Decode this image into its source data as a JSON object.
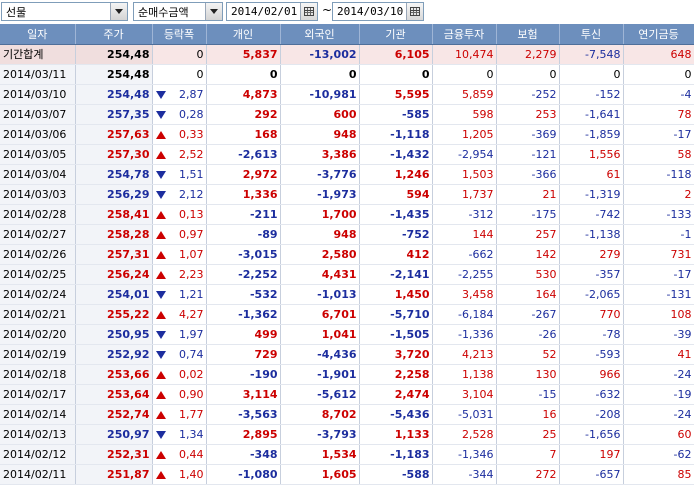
{
  "toolbar": {
    "market_select": "선물",
    "metric_select": "순매수금액",
    "start_date": "2014/02/01",
    "end_date": "2014/03/10",
    "range_separator": "~"
  },
  "colors": {
    "header_bg": "#6d8fbd",
    "up": "#cc0000",
    "down": "#1c2d9e",
    "summary_bg": "#f8e6e6"
  },
  "table": {
    "columns": [
      "일자",
      "주가",
      "등락폭",
      "개인",
      "외국인",
      "기관",
      "금융투자",
      "보험",
      "투신",
      "연기금등"
    ],
    "rows": [
      {
        "date": "기간합계",
        "price": "254,48",
        "price_c": "black",
        "dir": "",
        "chg": "0",
        "chg_c": "black",
        "ind": "5,837",
        "ind_c": "red",
        "for": "-13,002",
        "for_c": "blue",
        "inst": "6,105",
        "inst_c": "red",
        "fin": "10,474",
        "fin_c": "red",
        "ins": "2,279",
        "ins_c": "red",
        "tru": "-7,548",
        "tru_c": "blue",
        "pen": "648",
        "pen_c": "red",
        "summary": true
      },
      {
        "date": "2014/03/11",
        "price": "254,48",
        "price_c": "black",
        "dir": "",
        "chg": "0",
        "chg_c": "black",
        "ind": "0",
        "ind_c": "black",
        "for": "0",
        "for_c": "black",
        "inst": "0",
        "inst_c": "black",
        "fin": "0",
        "fin_c": "black",
        "ins": "0",
        "ins_c": "black",
        "tru": "0",
        "tru_c": "black",
        "pen": "0",
        "pen_c": "black"
      },
      {
        "date": "2014/03/10",
        "price": "254,48",
        "price_c": "blue",
        "dir": "down",
        "chg": "2,87",
        "chg_c": "blue",
        "ind": "4,873",
        "ind_c": "red",
        "for": "-10,981",
        "for_c": "blue",
        "inst": "5,595",
        "inst_c": "red",
        "fin": "5,859",
        "fin_c": "red",
        "ins": "-252",
        "ins_c": "blue",
        "tru": "-152",
        "tru_c": "blue",
        "pen": "-4",
        "pen_c": "blue"
      },
      {
        "date": "2014/03/07",
        "price": "257,35",
        "price_c": "blue",
        "dir": "down",
        "chg": "0,28",
        "chg_c": "blue",
        "ind": "292",
        "ind_c": "red",
        "for": "600",
        "for_c": "red",
        "inst": "-585",
        "inst_c": "blue",
        "fin": "598",
        "fin_c": "red",
        "ins": "253",
        "ins_c": "red",
        "tru": "-1,641",
        "tru_c": "blue",
        "pen": "78",
        "pen_c": "red"
      },
      {
        "date": "2014/03/06",
        "price": "257,63",
        "price_c": "red",
        "dir": "up",
        "chg": "0,33",
        "chg_c": "red",
        "ind": "168",
        "ind_c": "red",
        "for": "948",
        "for_c": "red",
        "inst": "-1,118",
        "inst_c": "blue",
        "fin": "1,205",
        "fin_c": "red",
        "ins": "-369",
        "ins_c": "blue",
        "tru": "-1,859",
        "tru_c": "blue",
        "pen": "-17",
        "pen_c": "blue"
      },
      {
        "date": "2014/03/05",
        "price": "257,30",
        "price_c": "red",
        "dir": "up",
        "chg": "2,52",
        "chg_c": "red",
        "ind": "-2,613",
        "ind_c": "blue",
        "for": "3,386",
        "for_c": "red",
        "inst": "-1,432",
        "inst_c": "blue",
        "fin": "-2,954",
        "fin_c": "blue",
        "ins": "-121",
        "ins_c": "blue",
        "tru": "1,556",
        "tru_c": "red",
        "pen": "58",
        "pen_c": "red"
      },
      {
        "date": "2014/03/04",
        "price": "254,78",
        "price_c": "blue",
        "dir": "down",
        "chg": "1,51",
        "chg_c": "blue",
        "ind": "2,972",
        "ind_c": "red",
        "for": "-3,776",
        "for_c": "blue",
        "inst": "1,246",
        "inst_c": "red",
        "fin": "1,503",
        "fin_c": "red",
        "ins": "-366",
        "ins_c": "blue",
        "tru": "61",
        "tru_c": "red",
        "pen": "-118",
        "pen_c": "blue"
      },
      {
        "date": "2014/03/03",
        "price": "256,29",
        "price_c": "blue",
        "dir": "down",
        "chg": "2,12",
        "chg_c": "blue",
        "ind": "1,336",
        "ind_c": "red",
        "for": "-1,973",
        "for_c": "blue",
        "inst": "594",
        "inst_c": "red",
        "fin": "1,737",
        "fin_c": "red",
        "ins": "21",
        "ins_c": "red",
        "tru": "-1,319",
        "tru_c": "blue",
        "pen": "2",
        "pen_c": "red"
      },
      {
        "date": "2014/02/28",
        "price": "258,41",
        "price_c": "red",
        "dir": "up",
        "chg": "0,13",
        "chg_c": "red",
        "ind": "-211",
        "ind_c": "blue",
        "for": "1,700",
        "for_c": "red",
        "inst": "-1,435",
        "inst_c": "blue",
        "fin": "-312",
        "fin_c": "blue",
        "ins": "-175",
        "ins_c": "blue",
        "tru": "-742",
        "tru_c": "blue",
        "pen": "-133",
        "pen_c": "blue"
      },
      {
        "date": "2014/02/27",
        "price": "258,28",
        "price_c": "red",
        "dir": "up",
        "chg": "0,97",
        "chg_c": "red",
        "ind": "-89",
        "ind_c": "blue",
        "for": "948",
        "for_c": "red",
        "inst": "-752",
        "inst_c": "blue",
        "fin": "144",
        "fin_c": "red",
        "ins": "257",
        "ins_c": "red",
        "tru": "-1,138",
        "tru_c": "blue",
        "pen": "-1",
        "pen_c": "blue"
      },
      {
        "date": "2014/02/26",
        "price": "257,31",
        "price_c": "red",
        "dir": "up",
        "chg": "1,07",
        "chg_c": "red",
        "ind": "-3,015",
        "ind_c": "blue",
        "for": "2,580",
        "for_c": "red",
        "inst": "412",
        "inst_c": "red",
        "fin": "-662",
        "fin_c": "blue",
        "ins": "142",
        "ins_c": "red",
        "tru": "279",
        "tru_c": "red",
        "pen": "731",
        "pen_c": "red"
      },
      {
        "date": "2014/02/25",
        "price": "256,24",
        "price_c": "red",
        "dir": "up",
        "chg": "2,23",
        "chg_c": "red",
        "ind": "-2,252",
        "ind_c": "blue",
        "for": "4,431",
        "for_c": "red",
        "inst": "-2,141",
        "inst_c": "blue",
        "fin": "-2,255",
        "fin_c": "blue",
        "ins": "530",
        "ins_c": "red",
        "tru": "-357",
        "tru_c": "blue",
        "pen": "-17",
        "pen_c": "blue"
      },
      {
        "date": "2014/02/24",
        "price": "254,01",
        "price_c": "blue",
        "dir": "down",
        "chg": "1,21",
        "chg_c": "blue",
        "ind": "-532",
        "ind_c": "blue",
        "for": "-1,013",
        "for_c": "blue",
        "inst": "1,450",
        "inst_c": "red",
        "fin": "3,458",
        "fin_c": "red",
        "ins": "164",
        "ins_c": "red",
        "tru": "-2,065",
        "tru_c": "blue",
        "pen": "-131",
        "pen_c": "blue"
      },
      {
        "date": "2014/02/21",
        "price": "255,22",
        "price_c": "red",
        "dir": "up",
        "chg": "4,27",
        "chg_c": "red",
        "ind": "-1,362",
        "ind_c": "blue",
        "for": "6,701",
        "for_c": "red",
        "inst": "-5,710",
        "inst_c": "blue",
        "fin": "-6,184",
        "fin_c": "blue",
        "ins": "-267",
        "ins_c": "blue",
        "tru": "770",
        "tru_c": "red",
        "pen": "108",
        "pen_c": "red"
      },
      {
        "date": "2014/02/20",
        "price": "250,95",
        "price_c": "blue",
        "dir": "down",
        "chg": "1,97",
        "chg_c": "blue",
        "ind": "499",
        "ind_c": "red",
        "for": "1,041",
        "for_c": "red",
        "inst": "-1,505",
        "inst_c": "blue",
        "fin": "-1,336",
        "fin_c": "blue",
        "ins": "-26",
        "ins_c": "blue",
        "tru": "-78",
        "tru_c": "blue",
        "pen": "-39",
        "pen_c": "blue"
      },
      {
        "date": "2014/02/19",
        "price": "252,92",
        "price_c": "blue",
        "dir": "down",
        "chg": "0,74",
        "chg_c": "blue",
        "ind": "729",
        "ind_c": "red",
        "for": "-4,436",
        "for_c": "blue",
        "inst": "3,720",
        "inst_c": "red",
        "fin": "4,213",
        "fin_c": "red",
        "ins": "52",
        "ins_c": "red",
        "tru": "-593",
        "tru_c": "blue",
        "pen": "41",
        "pen_c": "red"
      },
      {
        "date": "2014/02/18",
        "price": "253,66",
        "price_c": "red",
        "dir": "up",
        "chg": "0,02",
        "chg_c": "red",
        "ind": "-190",
        "ind_c": "blue",
        "for": "-1,901",
        "for_c": "blue",
        "inst": "2,258",
        "inst_c": "red",
        "fin": "1,138",
        "fin_c": "red",
        "ins": "130",
        "ins_c": "red",
        "tru": "966",
        "tru_c": "red",
        "pen": "-24",
        "pen_c": "blue"
      },
      {
        "date": "2014/02/17",
        "price": "253,64",
        "price_c": "red",
        "dir": "up",
        "chg": "0,90",
        "chg_c": "red",
        "ind": "3,114",
        "ind_c": "red",
        "for": "-5,612",
        "for_c": "blue",
        "inst": "2,474",
        "inst_c": "red",
        "fin": "3,104",
        "fin_c": "red",
        "ins": "-15",
        "ins_c": "blue",
        "tru": "-632",
        "tru_c": "blue",
        "pen": "-19",
        "pen_c": "blue"
      },
      {
        "date": "2014/02/14",
        "price": "252,74",
        "price_c": "red",
        "dir": "up",
        "chg": "1,77",
        "chg_c": "red",
        "ind": "-3,563",
        "ind_c": "blue",
        "for": "8,702",
        "for_c": "red",
        "inst": "-5,436",
        "inst_c": "blue",
        "fin": "-5,031",
        "fin_c": "blue",
        "ins": "16",
        "ins_c": "red",
        "tru": "-208",
        "tru_c": "blue",
        "pen": "-24",
        "pen_c": "blue"
      },
      {
        "date": "2014/02/13",
        "price": "250,97",
        "price_c": "blue",
        "dir": "down",
        "chg": "1,34",
        "chg_c": "blue",
        "ind": "2,895",
        "ind_c": "red",
        "for": "-3,793",
        "for_c": "blue",
        "inst": "1,133",
        "inst_c": "red",
        "fin": "2,528",
        "fin_c": "red",
        "ins": "25",
        "ins_c": "red",
        "tru": "-1,656",
        "tru_c": "blue",
        "pen": "60",
        "pen_c": "red"
      },
      {
        "date": "2014/02/12",
        "price": "252,31",
        "price_c": "red",
        "dir": "up",
        "chg": "0,44",
        "chg_c": "red",
        "ind": "-348",
        "ind_c": "blue",
        "for": "1,534",
        "for_c": "red",
        "inst": "-1,183",
        "inst_c": "blue",
        "fin": "-1,346",
        "fin_c": "blue",
        "ins": "7",
        "ins_c": "red",
        "tru": "197",
        "tru_c": "red",
        "pen": "-62",
        "pen_c": "blue"
      },
      {
        "date": "2014/02/11",
        "price": "251,87",
        "price_c": "red",
        "dir": "up",
        "chg": "1,40",
        "chg_c": "red",
        "ind": "-1,080",
        "ind_c": "blue",
        "for": "1,605",
        "for_c": "red",
        "inst": "-588",
        "inst_c": "blue",
        "fin": "-344",
        "fin_c": "blue",
        "ins": "272",
        "ins_c": "red",
        "tru": "-657",
        "tru_c": "blue",
        "pen": "85",
        "pen_c": "red"
      }
    ]
  }
}
